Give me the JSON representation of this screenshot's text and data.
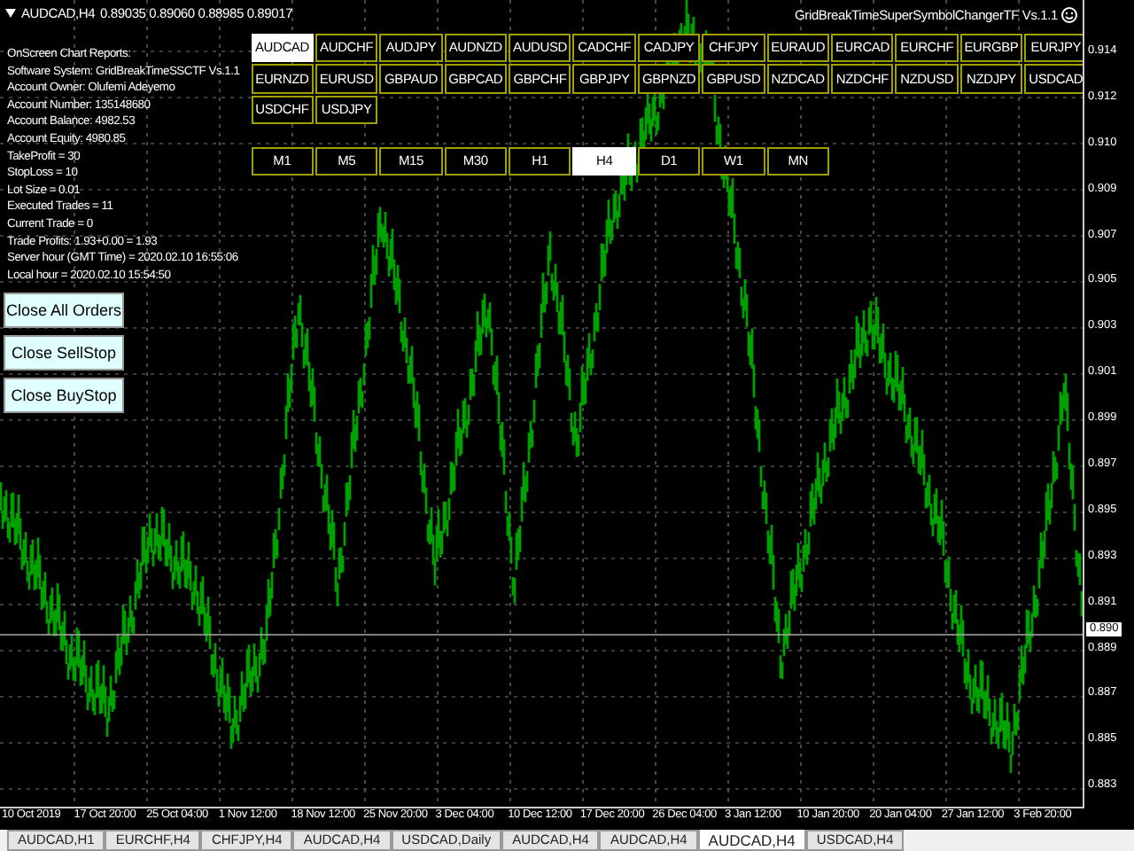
{
  "chart_header": {
    "symbol": "AUDCAD,H4",
    "quotes": "0.89035 0.89060 0.88985 0.89017"
  },
  "indicator_title": "GridBreakTimeSuperSymbolChangerTF Vs.1.1",
  "report_lines": [
    "OnScreen Chart Reports:",
    "Software System: GridBreakTimeSSCTF Vs.1.1",
    "Account Owner: Olufemi Adeyemo",
    "Account Number: 135148680",
    "Account Balance: 4982.53",
    "Account Equity: 4980.85",
    "TakeProfit = 30",
    "StopLoss = 10",
    "Lot Size = 0.01",
    "Executed Trades = 11",
    "Current Trade = 0",
    "Trade Profits: 1.93+0.00 = 1.93",
    "Server hour (GMT Time) = 2020.02.10 16:55:06",
    "Local hour = 2020.02.10 15:54:50"
  ],
  "order_buttons": [
    "Close All Orders",
    "Close SellStop",
    "Close BuyStop"
  ],
  "symbols": [
    {
      "label": "AUDCAD",
      "selected": true
    },
    {
      "label": "AUDCHF",
      "selected": false
    },
    {
      "label": "AUDJPY",
      "selected": false
    },
    {
      "label": "AUDNZD",
      "selected": false
    },
    {
      "label": "AUDUSD",
      "selected": false
    },
    {
      "label": "CADCHF",
      "selected": false
    },
    {
      "label": "CADJPY",
      "selected": false
    },
    {
      "label": "CHFJPY",
      "selected": false
    },
    {
      "label": "EURAUD",
      "selected": false
    },
    {
      "label": "EURCAD",
      "selected": false
    },
    {
      "label": "EURCHF",
      "selected": false
    },
    {
      "label": "EURGBP",
      "selected": false
    },
    {
      "label": "EURJPY",
      "selected": false
    },
    {
      "label": "EURNZD",
      "selected": false
    },
    {
      "label": "EURUSD",
      "selected": false
    },
    {
      "label": "GBPAUD",
      "selected": false
    },
    {
      "label": "GBPCAD",
      "selected": false
    },
    {
      "label": "GBPCHF",
      "selected": false
    },
    {
      "label": "GBPJPY",
      "selected": false
    },
    {
      "label": "GBPNZD",
      "selected": false
    },
    {
      "label": "GBPUSD",
      "selected": false
    },
    {
      "label": "NZDCAD",
      "selected": false
    },
    {
      "label": "NZDCHF",
      "selected": false
    },
    {
      "label": "NZDUSD",
      "selected": false
    },
    {
      "label": "NZDJPY",
      "selected": false
    },
    {
      "label": "USDCAD",
      "selected": false
    },
    {
      "label": "USDCHF",
      "selected": false
    },
    {
      "label": "USDJPY",
      "selected": false
    }
  ],
  "timeframes": [
    {
      "label": "M1",
      "selected": false
    },
    {
      "label": "M5",
      "selected": false
    },
    {
      "label": "M15",
      "selected": false
    },
    {
      "label": "M30",
      "selected": false
    },
    {
      "label": "H1",
      "selected": false
    },
    {
      "label": "H4",
      "selected": true
    },
    {
      "label": "D1",
      "selected": false
    },
    {
      "label": "W1",
      "selected": false
    },
    {
      "label": "MN",
      "selected": false
    }
  ],
  "price_axis": {
    "labels": [
      "0.914",
      "0.912",
      "0.910",
      "0.909",
      "0.907",
      "0.905",
      "0.903",
      "0.901",
      "0.899",
      "0.897",
      "0.895",
      "0.893",
      "0.891",
      "0.889",
      "0.887",
      "0.885",
      "0.883"
    ],
    "current_price": "0.890"
  },
  "time_axis": [
    "10 Oct 2019",
    "17 Oct 20:00",
    "25 Oct 04:00",
    "1 Nov 12:00",
    "18 Nov 12:00",
    "25 Nov 20:00",
    "3 Dec 04:00",
    "10 Dec 12:00",
    "17 Dec 20:00",
    "26 Dec 04:00",
    "3 Jan 12:00",
    "10 Jan 20:00",
    "20 Jan 04:00",
    "27 Jan 12:00",
    "3 Feb 20:00"
  ],
  "chart_tabs": [
    {
      "label": "AUDCAD,H1",
      "selected": false
    },
    {
      "label": "EURCHF,H4",
      "selected": false
    },
    {
      "label": "CHFJPY,H4",
      "selected": false
    },
    {
      "label": "AUDCAD,H4",
      "selected": false
    },
    {
      "label": "USDCAD,Daily",
      "selected": false
    },
    {
      "label": "AUDCAD,H4",
      "selected": false
    },
    {
      "label": "AUDCAD,H4",
      "selected": false
    },
    {
      "label": "AUDCAD,H4",
      "selected": true
    },
    {
      "label": "USDCAD,H4",
      "selected": false
    }
  ]
}
